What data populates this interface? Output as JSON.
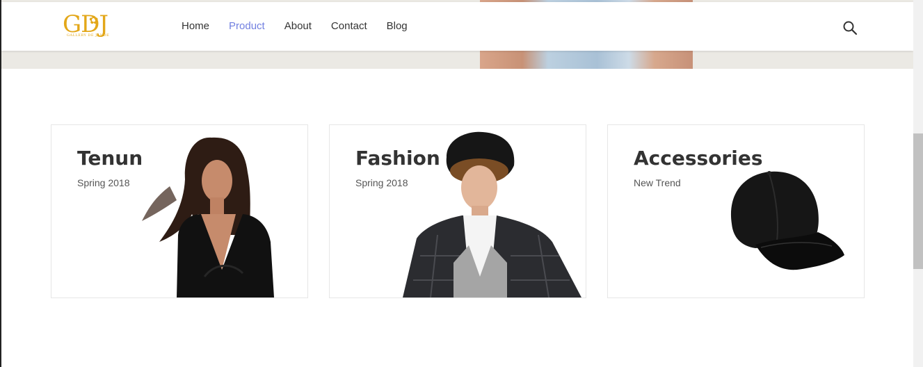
{
  "header": {
    "logo_text": "GDJ",
    "logo_subtext": "GALLERY DE JANDE",
    "nav": [
      {
        "label": "Home",
        "active": false
      },
      {
        "label": "Product",
        "active": true
      },
      {
        "label": "About",
        "active": false
      },
      {
        "label": "Contact",
        "active": false
      },
      {
        "label": "Blog",
        "active": false
      }
    ],
    "search_icon": "search-icon"
  },
  "banners": [
    {
      "title": "Tenun",
      "subtitle": "Spring 2018",
      "image": "woman-black-dress"
    },
    {
      "title": "Fashion",
      "subtitle": "Spring 2018",
      "image": "man-beret-blazer"
    },
    {
      "title": "Accessories",
      "subtitle": "New Trend",
      "image": "black-cap"
    }
  ],
  "colors": {
    "accent": "#717fe0",
    "logo": "#e3a719",
    "text": "#333333",
    "border": "#e6e6e6"
  }
}
